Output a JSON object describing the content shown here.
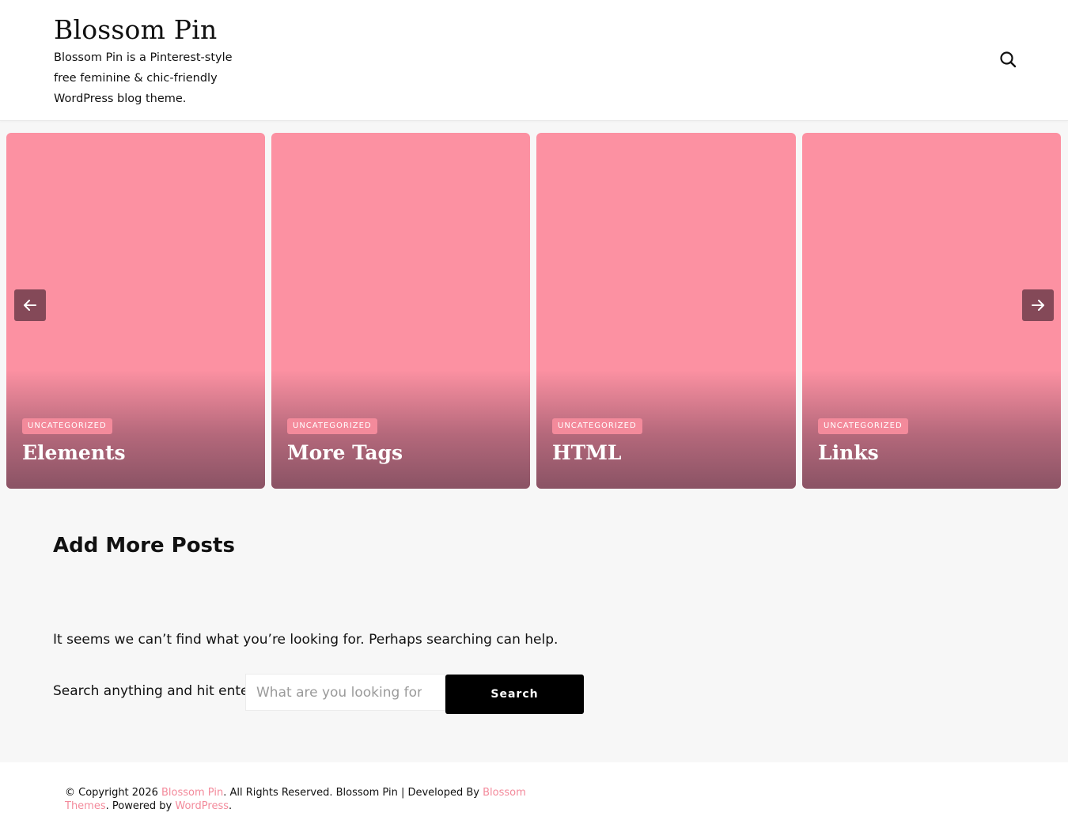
{
  "header": {
    "site_title": "Blossom Pin",
    "site_description": "Blossom Pin is a Pinterest-style free feminine & chic-friendly WordPress blog theme.",
    "search_icon": "search-icon"
  },
  "slider": {
    "slides": [
      {
        "category": "UNCATEGORIZED",
        "title": "Elements"
      },
      {
        "category": "UNCATEGORIZED",
        "title": "More Tags"
      },
      {
        "category": "UNCATEGORIZED",
        "title": "HTML"
      },
      {
        "category": "UNCATEGORIZED",
        "title": "Links"
      }
    ],
    "prev_icon": "arrow-left-icon",
    "next_icon": "arrow-right-icon",
    "slide_color": "#fc91a2",
    "badge_color": "#f38a9b"
  },
  "main": {
    "heading": "Add More Posts",
    "message": "It seems we can’t find what you’re looking for. Perhaps searching can help.",
    "search_label": "Search anything and hit enter.",
    "search_placeholder": "What are you looking for.",
    "search_button": "Search"
  },
  "footer": {
    "copyright_prefix": "© Copyright 2026 ",
    "site_link": "Blossom Pin",
    "rights_text": ". All Rights Reserved. Blossom Pin | Developed By ",
    "developer_link": "Blossom Themes",
    "powered_text": ". Powered by ",
    "wordpress_link": "WordPress",
    "end": "."
  },
  "colors": {
    "accent": "#f38a9b",
    "background": "#f7f7f7",
    "button": "#000000"
  }
}
